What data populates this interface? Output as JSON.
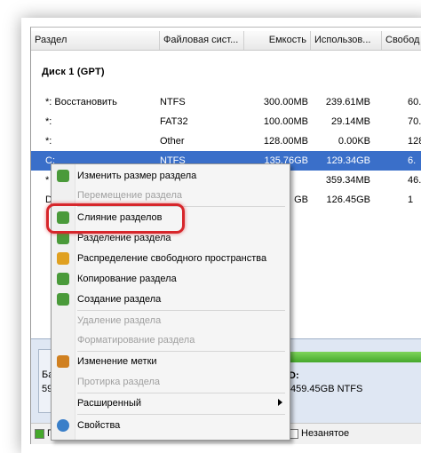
{
  "table": {
    "columns": [
      "Раздел",
      "Файловая сист...",
      "Емкость",
      "Использов...",
      "Свобод"
    ],
    "disk_title": "Диск 1 (GPT)",
    "rows": [
      {
        "name": "*: Восстановить",
        "fs": "NTFS",
        "capacity": "300.00MB",
        "used": "239.61MB",
        "free": "60."
      },
      {
        "name": "*:",
        "fs": "FAT32",
        "capacity": "100.00MB",
        "used": "29.14MB",
        "free": "70."
      },
      {
        "name": "*:",
        "fs": "Other",
        "capacity": "128.00MB",
        "used": "0.00KB",
        "free": "128"
      },
      {
        "name": "C:",
        "fs": "NTFS",
        "capacity": "135.76GB",
        "used": "129.34GB",
        "free": "6."
      },
      {
        "name": "*",
        "fs": "",
        "capacity": "",
        "used": "359.34MB",
        "free": "46."
      },
      {
        "name": "D",
        "fs": "",
        "capacity": "GB",
        "used": "126.45GB",
        "free": "1"
      }
    ]
  },
  "bottom": {
    "frag1": "Ба",
    "frag2": "59",
    "frag3": "D:",
    "frag4": "459.45GB NTFS"
  },
  "legend": {
    "item1_fragment": "П",
    "item2": "Незанятое"
  },
  "context_menu": {
    "items": [
      {
        "label": "Изменить размер раздела",
        "disabled": false,
        "icon": "resize-icon",
        "color": "#4a9a3a"
      },
      {
        "label": "Перемещение раздела",
        "disabled": true,
        "icon": "move-icon",
        "color": ""
      },
      {
        "label": "Слияние разделов",
        "disabled": false,
        "icon": "merge-icon",
        "color": "#4a9a3a"
      },
      {
        "label": "Разделение раздела",
        "disabled": false,
        "icon": "split-icon",
        "color": "#4a9a3a"
      },
      {
        "label": "Распределение свободного пространства",
        "disabled": false,
        "icon": "allocate-icon",
        "color": "#e0a020"
      },
      {
        "label": "Копирование раздела",
        "disabled": false,
        "icon": "copy-icon",
        "color": "#4a9a3a"
      },
      {
        "label": "Создание раздела",
        "disabled": false,
        "icon": "create-icon",
        "color": "#4a9a3a"
      },
      {
        "label": "Удаление раздела",
        "disabled": true,
        "icon": "delete-icon",
        "color": ""
      },
      {
        "label": "Форматирование раздела",
        "disabled": true,
        "icon": "format-icon",
        "color": ""
      },
      {
        "label": "Изменение метки",
        "disabled": false,
        "icon": "label-icon",
        "color": "#d08020"
      },
      {
        "label": "Протирка раздела",
        "disabled": true,
        "icon": "wipe-icon",
        "color": ""
      },
      {
        "label": "Расширенный",
        "disabled": false,
        "icon": "advanced-icon",
        "color": "",
        "submenu": true
      },
      {
        "label": "Свойства",
        "disabled": false,
        "icon": "properties-icon",
        "color": "#3a7fc9"
      }
    ]
  },
  "colors": {
    "selection": "#3a6fc9",
    "highlight_ring": "#d7262b",
    "usage_bar": "#45a82b"
  }
}
